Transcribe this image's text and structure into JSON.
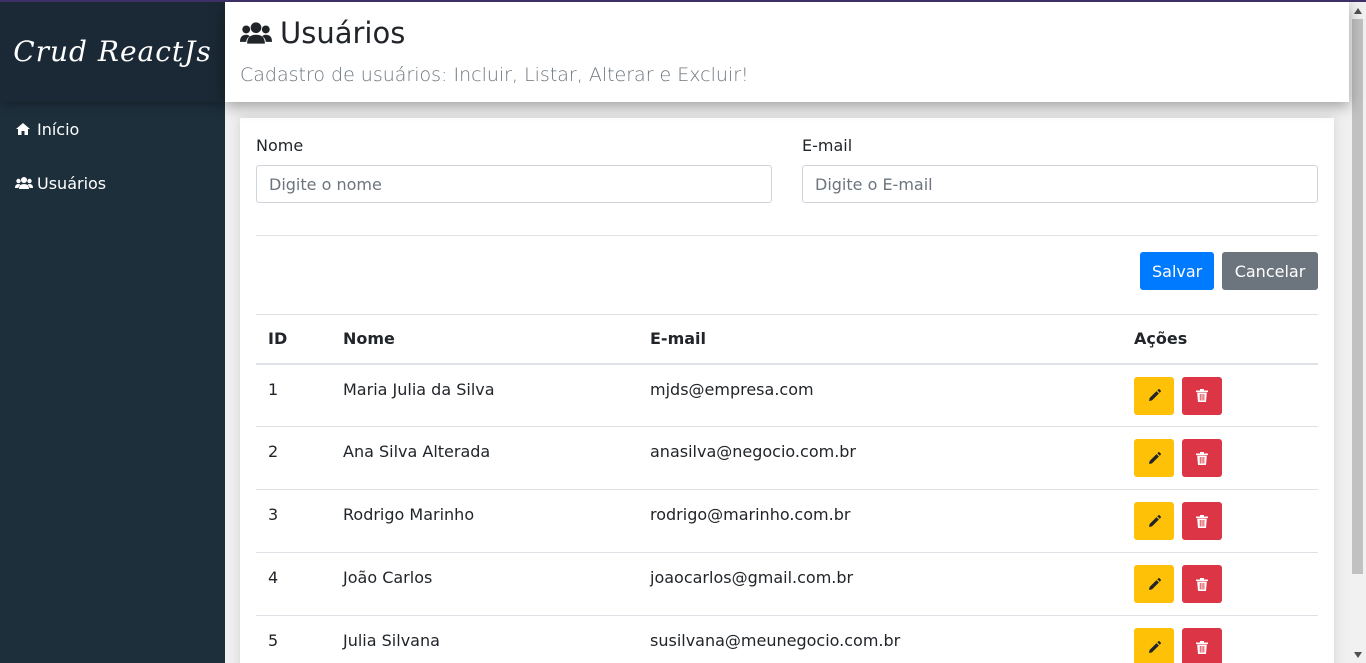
{
  "sidebar": {
    "logo": "Crud ReactJs",
    "items": [
      {
        "label": "Início",
        "icon": "home-icon"
      },
      {
        "label": "Usuários",
        "icon": "users-icon"
      }
    ]
  },
  "header": {
    "title": "Usuários",
    "icon": "users-icon",
    "subtitle": "Cadastro de usuários: Incluir, Listar, Alterar e Excluir!"
  },
  "form": {
    "name_label": "Nome",
    "name_placeholder": "Digite o nome",
    "name_value": "",
    "email_label": "E-mail",
    "email_placeholder": "Digite o E-mail",
    "email_value": "",
    "save_label": "Salvar",
    "cancel_label": "Cancelar"
  },
  "table": {
    "headers": [
      "ID",
      "Nome",
      "E-mail",
      "Ações"
    ],
    "rows": [
      {
        "id": "1",
        "nome": "Maria Julia da Silva",
        "email": "mjds@empresa.com"
      },
      {
        "id": "2",
        "nome": "Ana Silva Alterada",
        "email": "anasilva@negocio.com.br"
      },
      {
        "id": "3",
        "nome": "Rodrigo Marinho",
        "email": "rodrigo@marinho.com.br"
      },
      {
        "id": "4",
        "nome": "João Carlos",
        "email": "joaocarlos@gmail.com.br"
      },
      {
        "id": "5",
        "nome": "Julia Silvana",
        "email": "susilvana@meunegocio.com.br"
      }
    ],
    "edit_icon": "pencil-icon",
    "delete_icon": "trash-icon"
  },
  "colors": {
    "sidebar_bg": "#1e2f3c",
    "primary": "#007bff",
    "secondary": "#6c757d",
    "warning": "#ffc107",
    "danger": "#dc3545"
  }
}
